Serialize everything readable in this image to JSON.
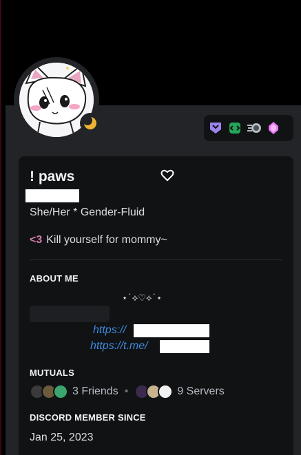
{
  "profile": {
    "display_name": "! paws",
    "pronouns": "She/Her * Gender-Fluid",
    "custom_status": {
      "emoji_text": "<3",
      "text": "Kill yourself for mommy~"
    },
    "status_icon": "moon-idle-icon",
    "badges": [
      "hypesquad-icon",
      "active-developer-icon",
      "quest-icon",
      "nitro-boost-gem-icon"
    ]
  },
  "about": {
    "title": "ABOUT ME",
    "decoration": "⋆˙⟡♡⟡˙⋆",
    "link1_prefix": "https://",
    "link2_prefix": "https://t.me/"
  },
  "mutuals": {
    "title": "MUTUALS",
    "friends": "3 Friends",
    "servers": "9 Servers"
  },
  "member_since": {
    "title": "DISCORD MEMBER SINCE",
    "date": "Jan 25, 2023"
  },
  "colors": {
    "card": "#232428",
    "inner": "#111214",
    "link": "#3d8ae0",
    "status_moon": "#f0b232"
  }
}
